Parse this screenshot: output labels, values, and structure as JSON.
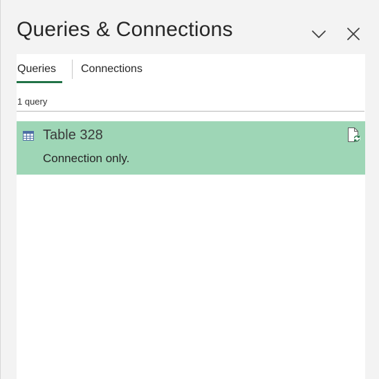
{
  "pane": {
    "title": "Queries & Connections"
  },
  "tabs": [
    {
      "label": "Queries",
      "active": true
    },
    {
      "label": "Connections",
      "active": false
    }
  ],
  "query_count_text": "1 query",
  "queries": [
    {
      "name": "Table 328",
      "status": "Connection only.",
      "icon": "table-icon",
      "selected": true
    }
  ],
  "icons": {
    "collapse": "chevron-down-icon",
    "close": "close-icon",
    "refresh": "document-refresh-icon"
  },
  "colors": {
    "accent": "#217346",
    "selected_row": "#9ed6b6",
    "pane_background": "#f3f3f3",
    "content_background": "#ffffff"
  }
}
